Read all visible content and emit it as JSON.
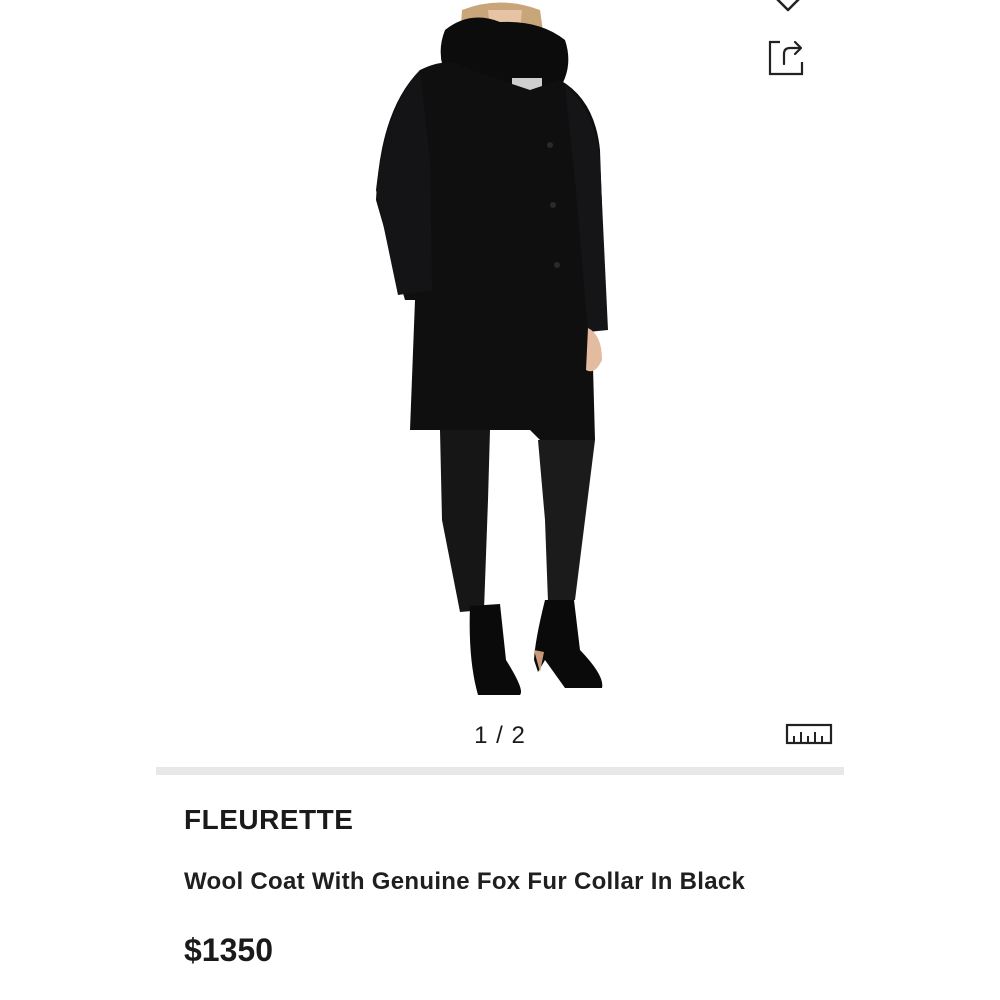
{
  "product": {
    "image_alt": "Model wearing black wool coat with fox fur collar",
    "brand": "FLEURETTE",
    "title": "Wool Coat With Genuine Fox Fur Collar In Black",
    "price": "$1350"
  },
  "gallery": {
    "pager": "1 / 2"
  },
  "icons": {
    "wishlist": "heart-icon",
    "share": "share-icon",
    "size_guide": "ruler-icon"
  },
  "colors": {
    "divider": "#e8e8e8",
    "text": "#1a1a1a"
  }
}
